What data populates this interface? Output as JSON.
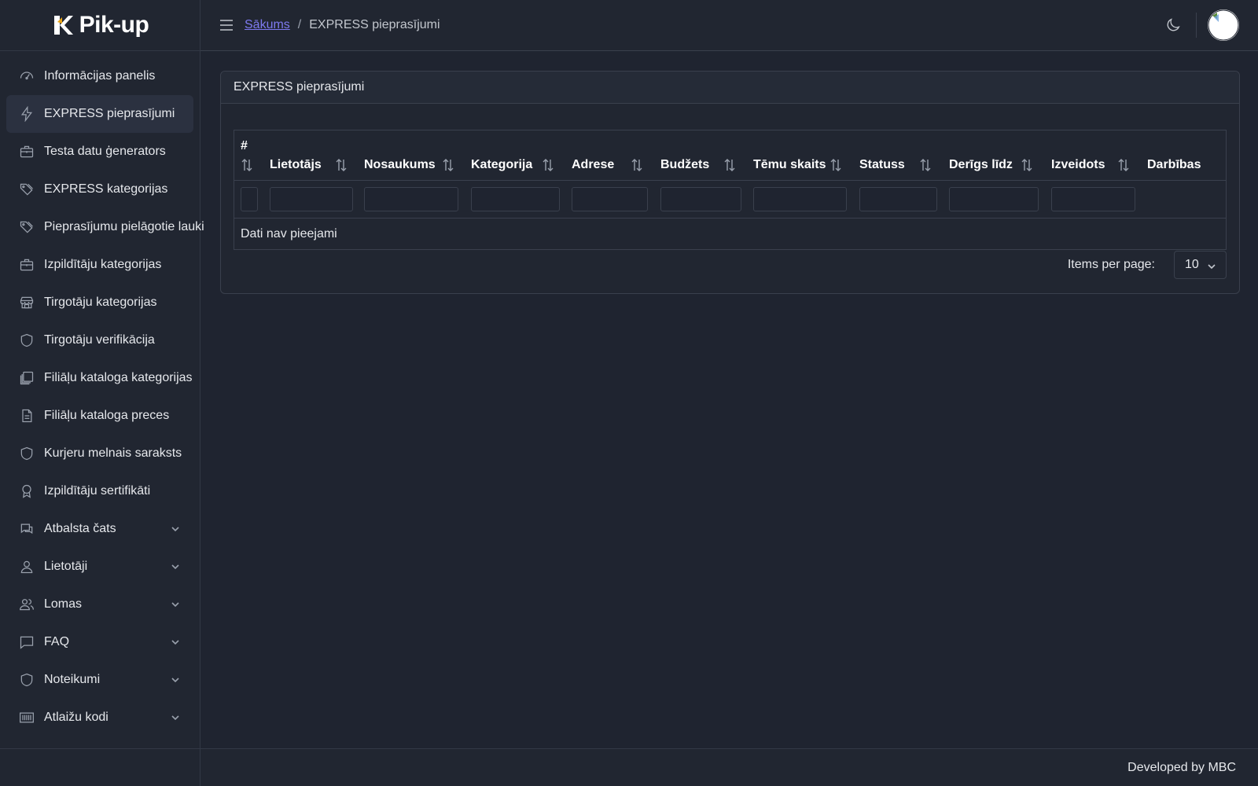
{
  "brand": {
    "name": "Pik-up"
  },
  "sidebar": {
    "items": [
      {
        "label": "Informācijas panelis",
        "icon": "speedometer-icon"
      },
      {
        "label": "EXPRESS pieprasījumi",
        "icon": "lightning-icon",
        "active": true
      },
      {
        "label": "Testa datu ģenerators",
        "icon": "briefcase-icon"
      },
      {
        "label": "EXPRESS kategorijas",
        "icon": "tags-icon"
      },
      {
        "label": "Pieprasījumu pielāgotie lauki",
        "icon": "tags-icon"
      },
      {
        "label": "Izpildītāju kategorijas",
        "icon": "briefcase-icon"
      },
      {
        "label": "Tirgotāju kategorijas",
        "icon": "store-icon"
      },
      {
        "label": "Tirgotāju verifikācija",
        "icon": "shield-icon"
      },
      {
        "label": "Filiāļu kataloga kategorijas",
        "icon": "layers-icon"
      },
      {
        "label": "Filiāļu kataloga preces",
        "icon": "document-icon"
      },
      {
        "label": "Kurjeru melnais saraksts",
        "icon": "shield-icon"
      },
      {
        "label": "Izpildītāju sertifikāti",
        "icon": "award-icon"
      },
      {
        "label": "Atbalsta čats",
        "icon": "chat-icon",
        "expandable": true
      },
      {
        "label": "Lietotāji",
        "icon": "user-icon",
        "expandable": true
      },
      {
        "label": "Lomas",
        "icon": "users-icon",
        "expandable": true
      },
      {
        "label": "FAQ",
        "icon": "message-square-icon",
        "expandable": true
      },
      {
        "label": "Noteikumi",
        "icon": "shield-icon",
        "expandable": true
      },
      {
        "label": "Atlaižu kodi",
        "icon": "barcode-icon",
        "expandable": true
      }
    ]
  },
  "header": {
    "breadcrumb_home": "Sākums",
    "breadcrumb_separator": "/",
    "breadcrumb_current": "EXPRESS pieprasījumi"
  },
  "card": {
    "title": "EXPRESS pieprasījumi",
    "columns": [
      "#",
      "Lietotājs",
      "Nosaukums",
      "Kategorija",
      "Adrese",
      "Budžets",
      "Tēmu skaits",
      "Statuss",
      "Derīgs līdz",
      "Izveidots",
      "Darbības"
    ],
    "empty_text": "Dati nav pieejami",
    "items_per_page_label": "Items per page:",
    "items_per_page_value": "10"
  },
  "footer": {
    "text": "Developed by MBC"
  },
  "colors": {
    "accent": "#7d7af0",
    "background": "#1f2430",
    "surface": "#212631",
    "border": "#3a404d"
  }
}
